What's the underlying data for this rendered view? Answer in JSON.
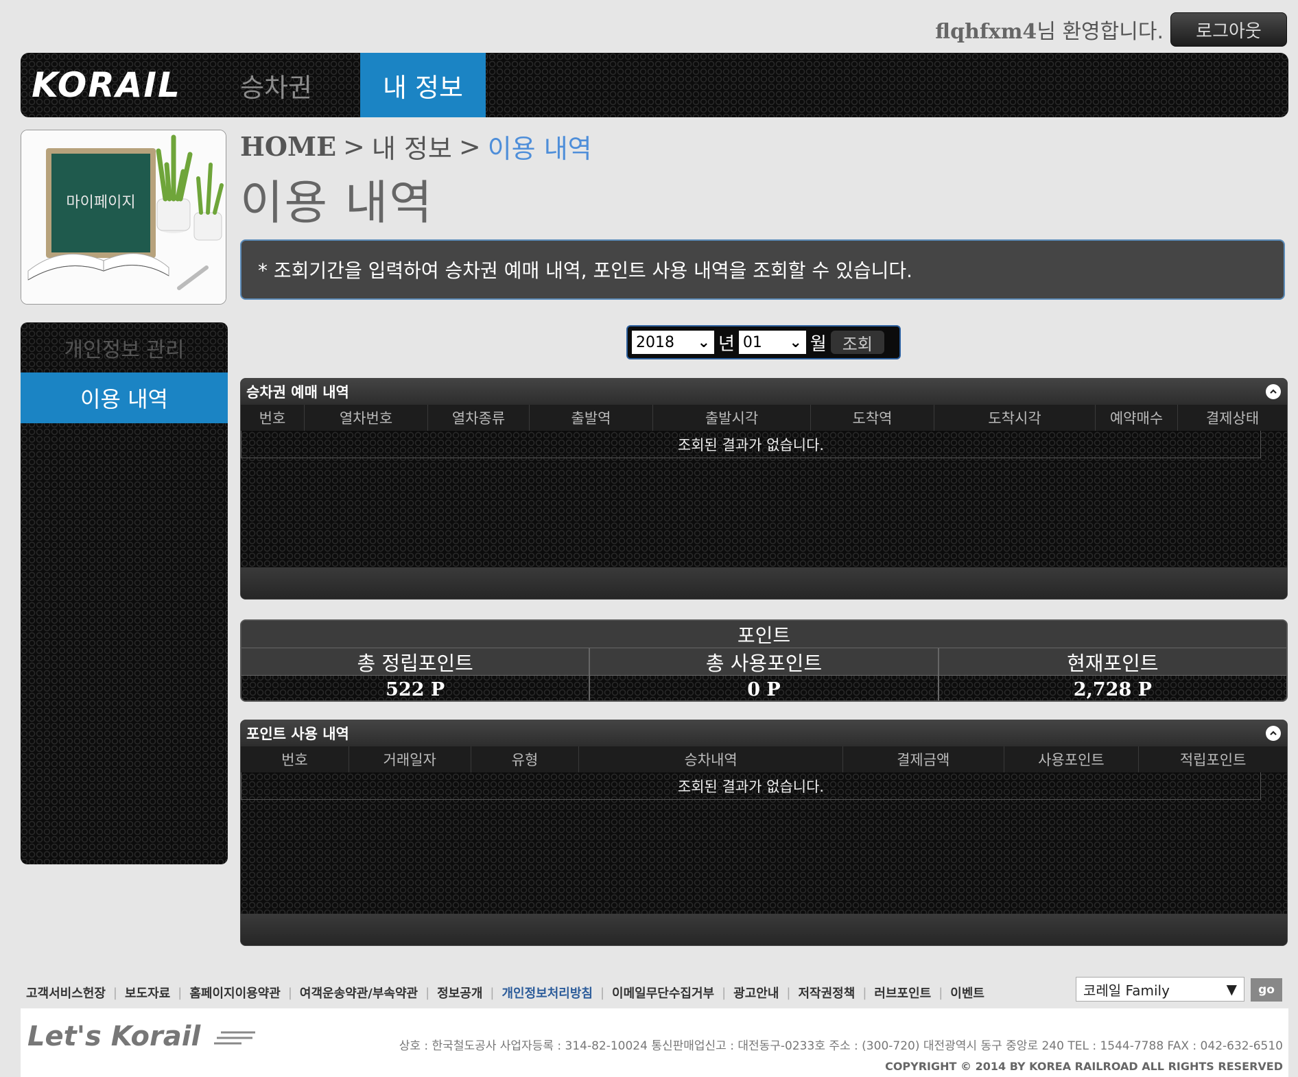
{
  "user": {
    "id": "flqhfxm4",
    "welcome_suffix": "님 환영합니다.",
    "logout_label": "로그아웃"
  },
  "header": {
    "logo": "KORAIL",
    "tabs": [
      {
        "label": "승차권",
        "active": false
      },
      {
        "label": "내 정보",
        "active": true
      }
    ]
  },
  "side_image_label": "마이페이지",
  "breadcrumb": {
    "home": "HOME",
    "sep": ">",
    "parent": "내 정보",
    "current": "이용 내역"
  },
  "page_title": "이용 내역",
  "info_text": "* 조회기간을 입력하여 승차권 예매 내역, 포인트 사용 내역을 조회할 수 있습니다.",
  "left_menu": {
    "head": "개인정보 관리",
    "items": [
      {
        "label": "이용 내역",
        "active": true
      }
    ]
  },
  "date_search": {
    "year": "2018",
    "year_unit": "년",
    "month": "01",
    "month_unit": "월",
    "button": "조회"
  },
  "ticket_history": {
    "title": "승차권 예매 내역",
    "columns": [
      "번호",
      "열차번호",
      "열차종류",
      "출발역",
      "출발시각",
      "도착역",
      "도착시각",
      "예약매수",
      "결제상태"
    ],
    "empty_text": "조회된 결과가 없습니다."
  },
  "points": {
    "title": "포인트",
    "headers": [
      "총 정립포인트",
      "총 사용포인트",
      "현재포인트"
    ],
    "values": [
      "522 P",
      "0 P",
      "2,728 P"
    ]
  },
  "point_history": {
    "title": "포인트 사용 내역",
    "columns": [
      "번호",
      "거래일자",
      "유형",
      "승차내역",
      "결제금액",
      "사용포인트",
      "적립포인트"
    ],
    "empty_text": "조회된 결과가 없습니다."
  },
  "footer": {
    "links": [
      "고객서비스헌장",
      "보도자료",
      "홈페이지이용약관",
      "여객운송약관/부속약관",
      "정보공개",
      "개인정보처리방침",
      "이메일무단수집거부",
      "광고안내",
      "저작권정책",
      "러브포인트",
      "이벤트"
    ],
    "highlight_link": "개인정보처리방침",
    "family_select": "코레일 Family",
    "go_label": "go",
    "logo": "Let's Korail",
    "info": "상호 : 한국철도공사    사업자등록 : 314-82-10024    통신판매업신고 : 대전동구-0233호    주소 : (300-720) 대전광역시 동구 중앙로 240    TEL : 1544-7788    FAX : 042-632-6510",
    "copyright": "COPYRIGHT © 2014 BY KOREA RAILROAD  ALL RIGHTS RESERVED"
  },
  "colors": {
    "accent_blue": "#1b84c4",
    "breadcrumb_current": "#4e8ed9",
    "background": "#e6e6e6"
  }
}
